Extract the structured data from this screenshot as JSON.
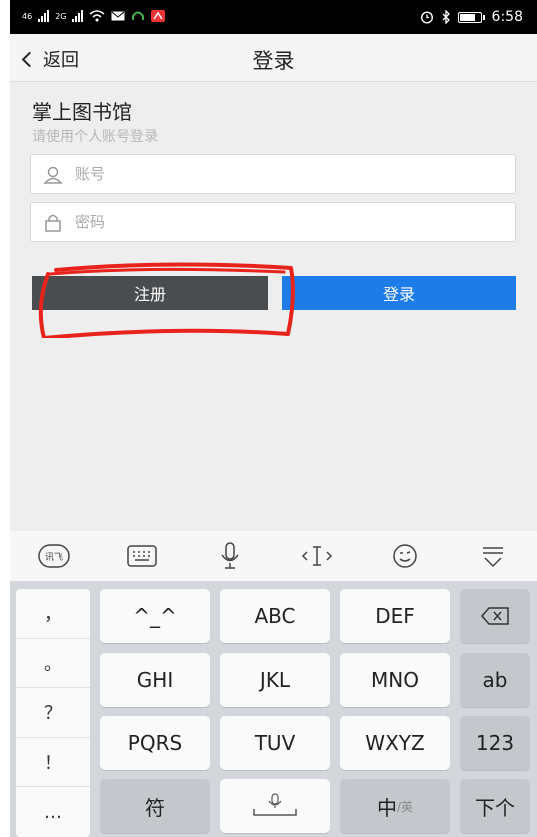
{
  "status_bar": {
    "sig1": "46",
    "sig2": "2G",
    "time": "6:58"
  },
  "header": {
    "back_label": "返回",
    "title": "登录"
  },
  "main": {
    "heading": "掌上图书馆",
    "subheading": "请使用个人账号登录",
    "account_placeholder": "账号",
    "password_placeholder": "密码",
    "register_label": "注册",
    "login_label": "登录",
    "colors": {
      "register": "#4a4d50",
      "login": "#1e7ce8",
      "annotation": "#e8231c"
    }
  },
  "keyboard": {
    "toolbar_icons": [
      "iflytek-logo-icon",
      "keyboard-icon",
      "microphone-icon",
      "cursor-icon",
      "emoji-icon",
      "collapse-icon"
    ],
    "logo_text": "讯飞",
    "punctuation": [
      "，",
      "。",
      "？",
      "！",
      "…"
    ],
    "rows": [
      [
        "^_^",
        "ABC",
        "DEF",
        "⌫"
      ],
      [
        "GHI",
        "JKL",
        "MNO",
        "ab"
      ],
      [
        "PQRS",
        "TUV",
        "WXYZ",
        "123"
      ],
      [
        "符",
        "space",
        "中/英",
        "下个"
      ]
    ],
    "labels": {
      "smiley": "^_^",
      "abc": "ABC",
      "def": "DEF",
      "ghi": "GHI",
      "jkl": "JKL",
      "mno": "MNO",
      "ab": "ab",
      "pqrs": "PQRS",
      "tuv": "TUV",
      "wxyz": "WXYZ",
      "num": "123",
      "symbol": "符",
      "lang_main": "中",
      "lang_sub": "英",
      "next": "下个"
    }
  }
}
